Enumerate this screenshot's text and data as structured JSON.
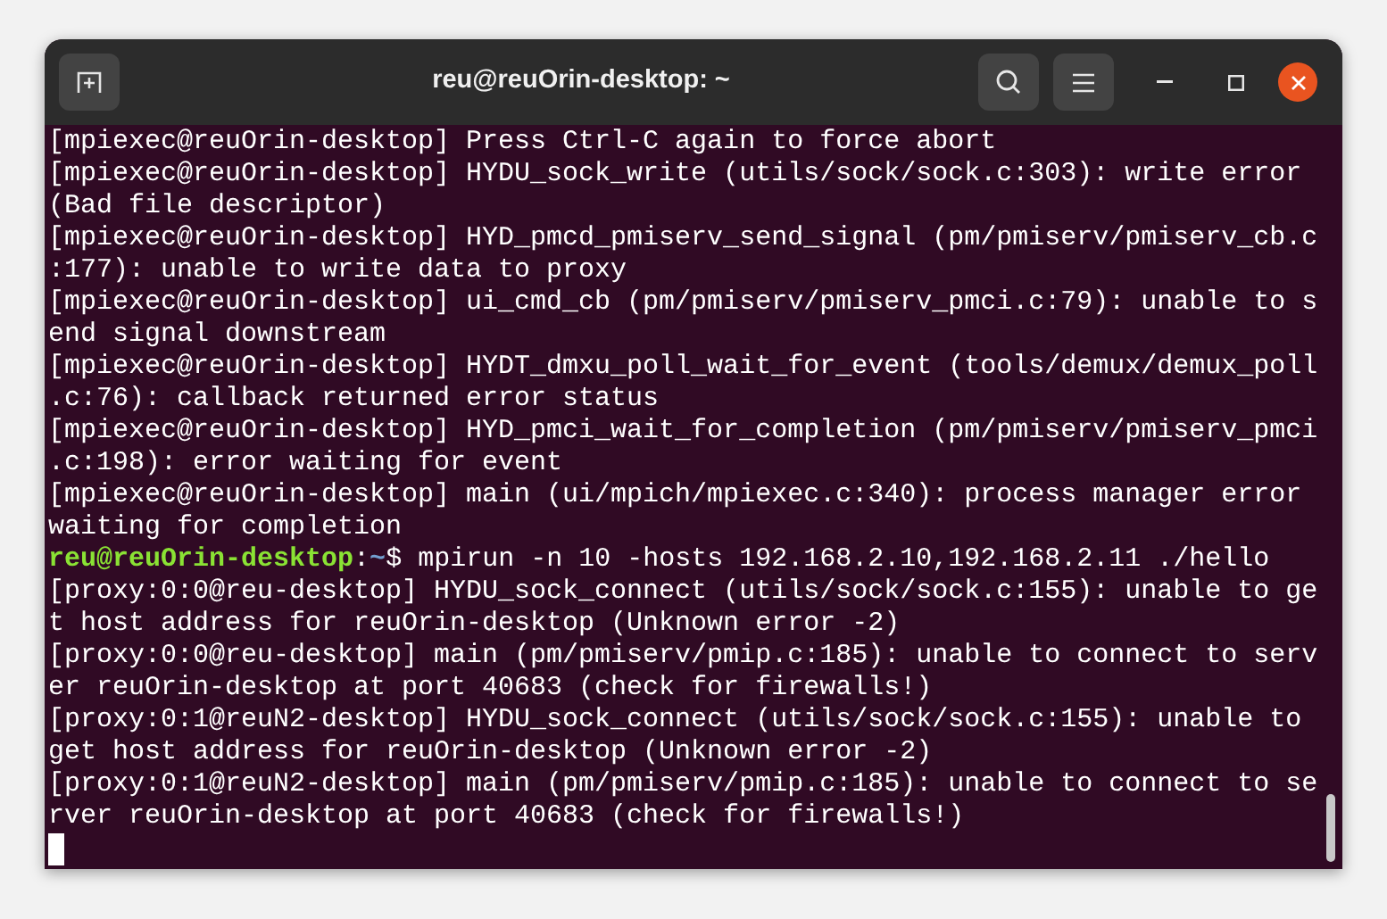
{
  "window": {
    "title": "reu@reuOrin-desktop: ~"
  },
  "terminal": {
    "rows": [
      {
        "kind": "output",
        "text": "[mpiexec@reuOrin-desktop] Press Ctrl-C again to force abort"
      },
      {
        "kind": "output",
        "text": "[mpiexec@reuOrin-desktop] HYDU_sock_write (utils/sock/sock.c:303): write error"
      },
      {
        "kind": "output",
        "text": "(Bad file descriptor)"
      },
      {
        "kind": "output",
        "text": "[mpiexec@reuOrin-desktop] HYD_pmcd_pmiserv_send_signal (pm/pmiserv/pmiserv_cb.c"
      },
      {
        "kind": "output",
        "text": ":177): unable to write data to proxy"
      },
      {
        "kind": "output",
        "text": "[mpiexec@reuOrin-desktop] ui_cmd_cb (pm/pmiserv/pmiserv_pmci.c:79): unable to s"
      },
      {
        "kind": "output",
        "text": "end signal downstream"
      },
      {
        "kind": "output",
        "text": "[mpiexec@reuOrin-desktop] HYDT_dmxu_poll_wait_for_event (tools/demux/demux_poll"
      },
      {
        "kind": "output",
        "text": ".c:76): callback returned error status"
      },
      {
        "kind": "output",
        "text": "[mpiexec@reuOrin-desktop] HYD_pmci_wait_for_completion (pm/pmiserv/pmiserv_pmci"
      },
      {
        "kind": "output",
        "text": ".c:198): error waiting for event"
      },
      {
        "kind": "output",
        "text": "[mpiexec@reuOrin-desktop] main (ui/mpich/mpiexec.c:340): process manager error"
      },
      {
        "kind": "output",
        "text": "waiting for completion"
      },
      {
        "kind": "prompt",
        "user_host": "reu@reuOrin-desktop",
        "separator": ":",
        "path": "~",
        "symbol": "$",
        "command": "mpirun -n 10 -hosts 192.168.2.10,192.168.2.11 ./hello"
      },
      {
        "kind": "output",
        "text": "[proxy:0:0@reu-desktop] HYDU_sock_connect (utils/sock/sock.c:155): unable to ge"
      },
      {
        "kind": "output",
        "text": "t host address for reuOrin-desktop (Unknown error -2)"
      },
      {
        "kind": "output",
        "text": "[proxy:0:0@reu-desktop] main (pm/pmiserv/pmip.c:185): unable to connect to serv"
      },
      {
        "kind": "output",
        "text": "er reuOrin-desktop at port 40683 (check for firewalls!)"
      },
      {
        "kind": "output",
        "text": "[proxy:0:1@reuN2-desktop] HYDU_sock_connect (utils/sock/sock.c:155): unable to"
      },
      {
        "kind": "output",
        "text": "get host address for reuOrin-desktop (Unknown error -2)"
      },
      {
        "kind": "output",
        "text": "[proxy:0:1@reuN2-desktop] main (pm/pmiserv/pmip.c:185): unable to connect to se"
      },
      {
        "kind": "output",
        "text": "rver reuOrin-desktop at port 40683 (check for firewalls!)"
      },
      {
        "kind": "cursor"
      }
    ]
  }
}
